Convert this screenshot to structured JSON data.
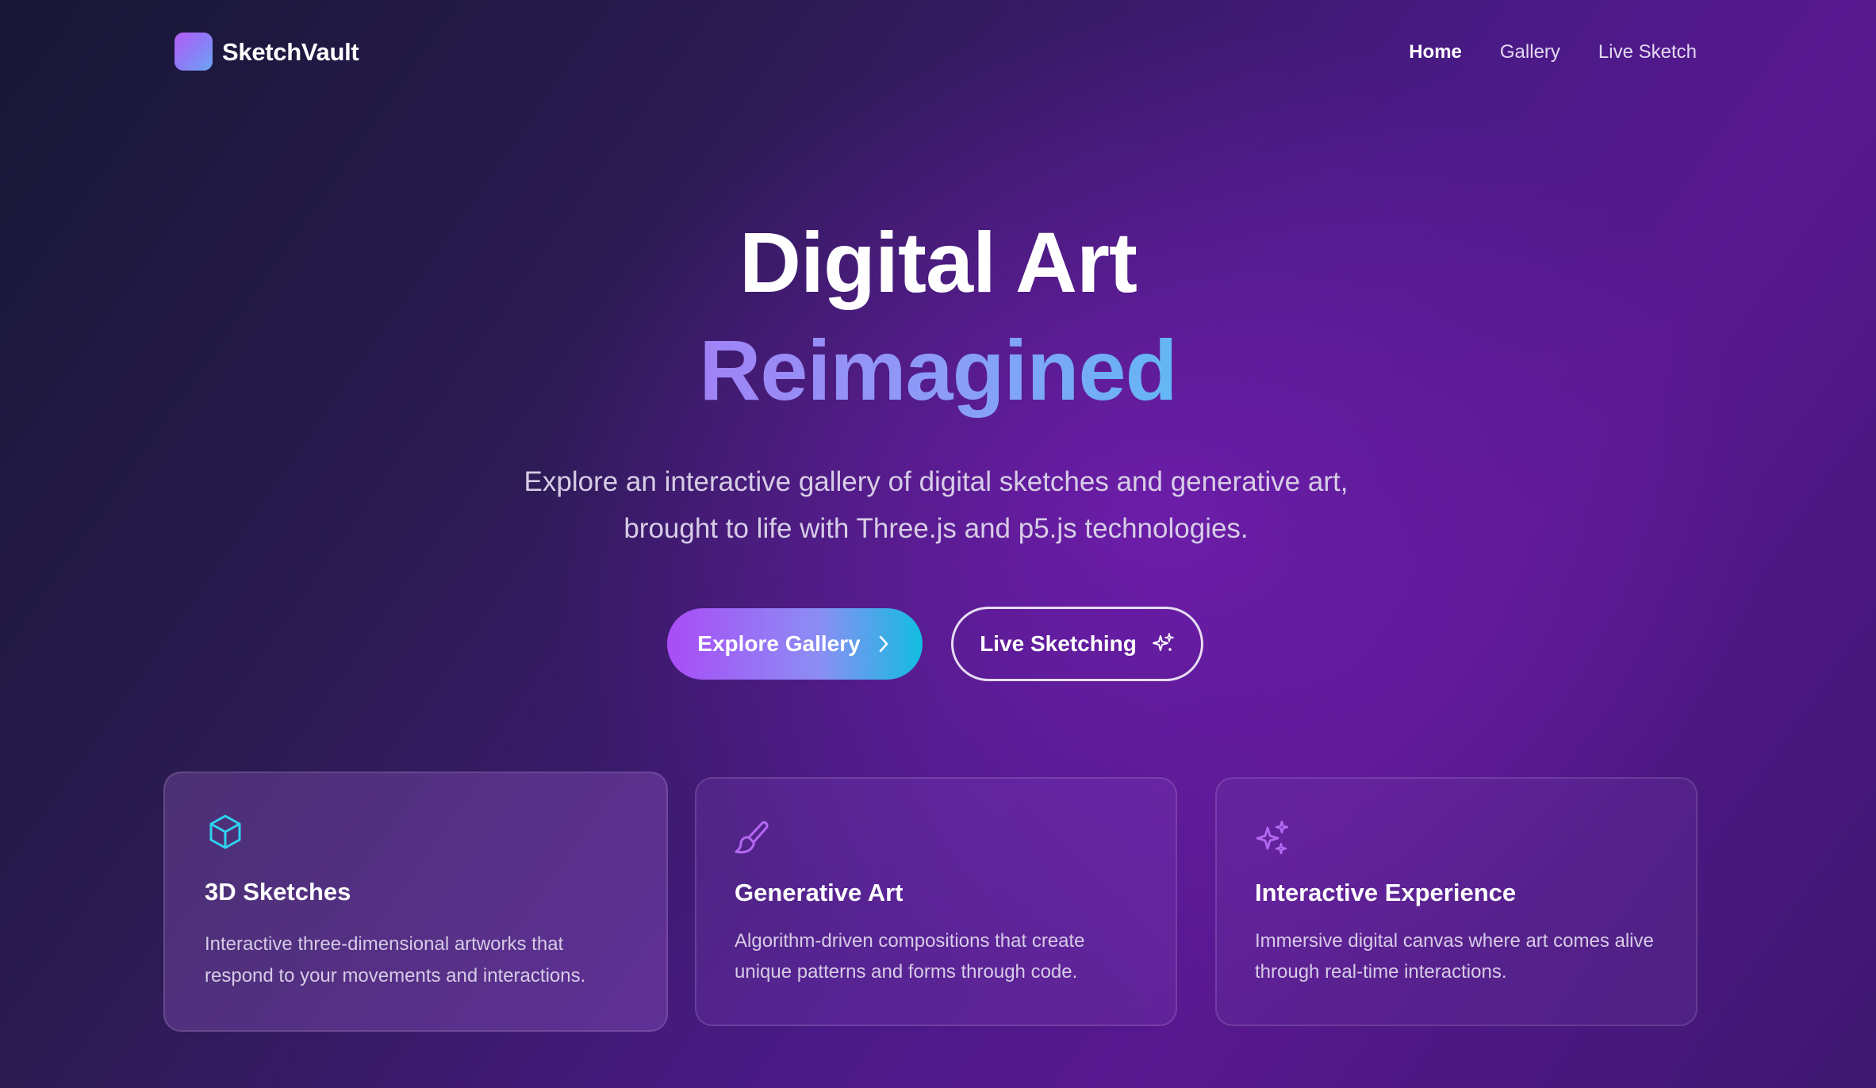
{
  "brand": {
    "name": "SketchVault"
  },
  "nav": {
    "items": [
      {
        "label": "Home"
      },
      {
        "label": "Gallery"
      },
      {
        "label": "Live Sketch"
      }
    ]
  },
  "hero": {
    "title_line1": "Digital Art",
    "title_line2": "Reimagined",
    "subtitle_line1": "Explore an interactive gallery of digital sketches and generative art,",
    "subtitle_line2": "brought to life with Three.js and p5.js technologies.",
    "primary_button": "Explore Gallery",
    "secondary_button": "Live Sketching"
  },
  "features": [
    {
      "icon": "cube-icon",
      "title": "3D Sketches",
      "description": "Interactive three-dimensional artworks that respond to your movements and interactions."
    },
    {
      "icon": "paintbrush-icon",
      "title": "Generative Art",
      "description": "Algorithm-driven compositions that create unique patterns and forms through code."
    },
    {
      "icon": "sparkles-icon",
      "title": "Interactive Experience",
      "description": "Immersive digital canvas where art comes alive through real-time interactions."
    }
  ],
  "colors": {
    "accent_purple": "#a94cf6",
    "accent_cyan": "#12bde0",
    "icon_cyan": "#2fd3f0",
    "icon_purple": "#b469f2"
  }
}
